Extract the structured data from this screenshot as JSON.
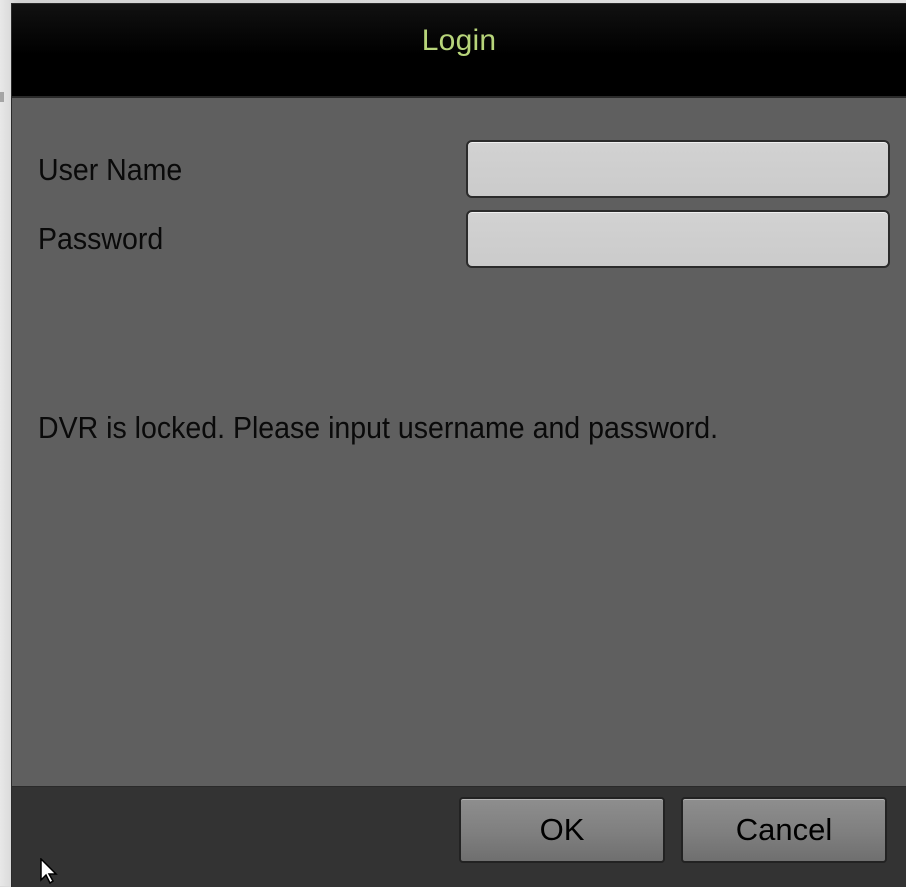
{
  "dialog": {
    "title": "Login"
  },
  "form": {
    "username_label": "User Name",
    "password_label": "Password",
    "username_value": "",
    "password_value": ""
  },
  "message": "DVR is locked. Please input username and password.",
  "buttons": {
    "ok_label": "OK",
    "cancel_label": "Cancel"
  },
  "colors": {
    "title_text": "#b7d47a",
    "dialog_bg": "#5f5f5f",
    "titlebar_bg": "#000000",
    "footer_bg": "#333333",
    "field_bg": "#cbcbcb"
  },
  "icons": {
    "cursor": "mouse-pointer-icon"
  }
}
